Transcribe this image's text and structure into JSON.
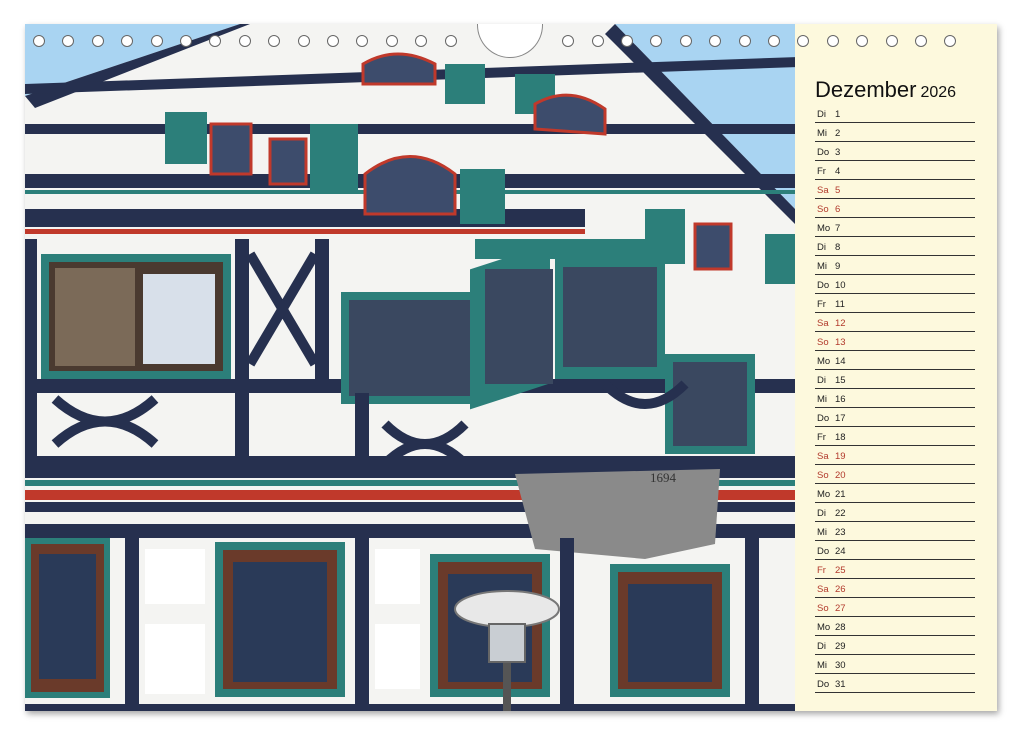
{
  "calendar": {
    "month": "Dezember",
    "year": "2026",
    "days": [
      {
        "dow": "Di",
        "num": "1",
        "kind": "weekday"
      },
      {
        "dow": "Mi",
        "num": "2",
        "kind": "weekday"
      },
      {
        "dow": "Do",
        "num": "3",
        "kind": "weekday"
      },
      {
        "dow": "Fr",
        "num": "4",
        "kind": "weekday"
      },
      {
        "dow": "Sa",
        "num": "5",
        "kind": "weekend"
      },
      {
        "dow": "So",
        "num": "6",
        "kind": "weekend"
      },
      {
        "dow": "Mo",
        "num": "7",
        "kind": "weekday"
      },
      {
        "dow": "Di",
        "num": "8",
        "kind": "weekday"
      },
      {
        "dow": "Mi",
        "num": "9",
        "kind": "weekday"
      },
      {
        "dow": "Do",
        "num": "10",
        "kind": "weekday"
      },
      {
        "dow": "Fr",
        "num": "11",
        "kind": "weekday"
      },
      {
        "dow": "Sa",
        "num": "12",
        "kind": "weekend"
      },
      {
        "dow": "So",
        "num": "13",
        "kind": "weekend"
      },
      {
        "dow": "Mo",
        "num": "14",
        "kind": "weekday"
      },
      {
        "dow": "Di",
        "num": "15",
        "kind": "weekday"
      },
      {
        "dow": "Mi",
        "num": "16",
        "kind": "weekday"
      },
      {
        "dow": "Do",
        "num": "17",
        "kind": "weekday"
      },
      {
        "dow": "Fr",
        "num": "18",
        "kind": "weekday"
      },
      {
        "dow": "Sa",
        "num": "19",
        "kind": "weekend"
      },
      {
        "dow": "So",
        "num": "20",
        "kind": "weekend"
      },
      {
        "dow": "Mo",
        "num": "21",
        "kind": "weekday"
      },
      {
        "dow": "Di",
        "num": "22",
        "kind": "weekday"
      },
      {
        "dow": "Mi",
        "num": "23",
        "kind": "weekday"
      },
      {
        "dow": "Do",
        "num": "24",
        "kind": "weekday"
      },
      {
        "dow": "Fr",
        "num": "25",
        "kind": "holiday"
      },
      {
        "dow": "Sa",
        "num": "26",
        "kind": "weekend"
      },
      {
        "dow": "So",
        "num": "27",
        "kind": "weekend"
      },
      {
        "dow": "Mo",
        "num": "28",
        "kind": "weekday"
      },
      {
        "dow": "Di",
        "num": "29",
        "kind": "weekday"
      },
      {
        "dow": "Mi",
        "num": "30",
        "kind": "weekday"
      },
      {
        "dow": "Do",
        "num": "31",
        "kind": "weekday"
      }
    ]
  },
  "photo": {
    "bay_inscription": "1694"
  },
  "colors": {
    "timber": "#26304f",
    "plaster": "#f4f4f2",
    "shutter_green": "#2c7f7a",
    "trim_red": "#c0392b",
    "sky": "#a9d4f2",
    "panel_bg": "#fdf9dd",
    "weekend_red": "#b23a2c"
  }
}
